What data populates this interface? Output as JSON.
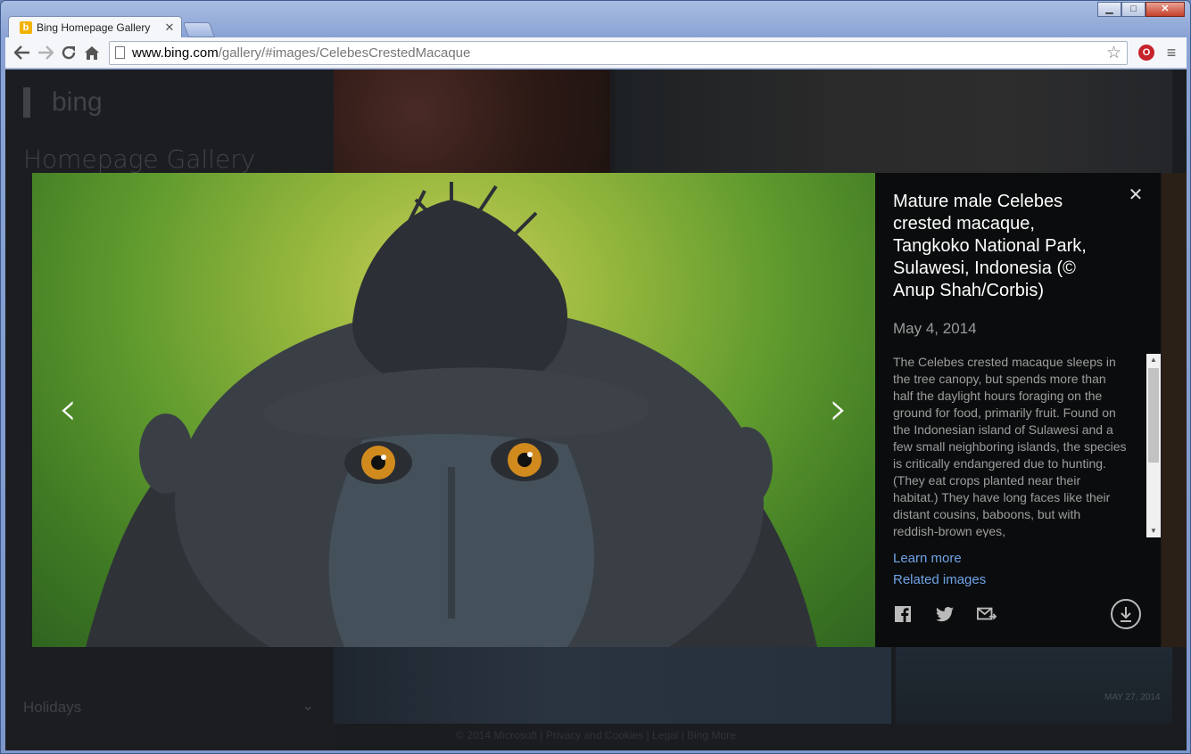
{
  "browser": {
    "tab_title": "Bing Homepage Gallery",
    "favicon_letter": "b",
    "url_host": "www.bing.com",
    "url_path": "/gallery/#images/CelebesCrestedMacaque",
    "window_controls": {
      "minimize": "▁",
      "maximize": "□",
      "close": "✕"
    }
  },
  "background_page": {
    "logo_text": "bing",
    "title": "Homepage Gallery",
    "holidays_label": "Holidays",
    "tile_date": "MAY 27, 2014",
    "footer": "© 2014 Microsoft | Privacy and Cookies | Legal | Bing More"
  },
  "lightbox": {
    "prev_label": "‹",
    "next_label": "›",
    "close_label": "✕",
    "caption": "Mature male Celebes crested macaque, Tangkoko National Park, Sulawesi, Indonesia (© Anup Shah/Corbis)",
    "date": "May 4, 2014",
    "description": "The Celebes crested macaque sleeps in the tree canopy, but spends more than half the daylight hours foraging on the ground for food, primarily fruit. Found on the Indonesian island of Sulawesi and a few small neighboring islands, the species is critically endangered due to hunting. (They eat crops planted near their habitat.) They have long faces like their distant cousins, baboons, but with reddish-brown eyes,",
    "learn_more": "Learn more",
    "related_images": "Related images",
    "scroll_position": 0.0
  }
}
